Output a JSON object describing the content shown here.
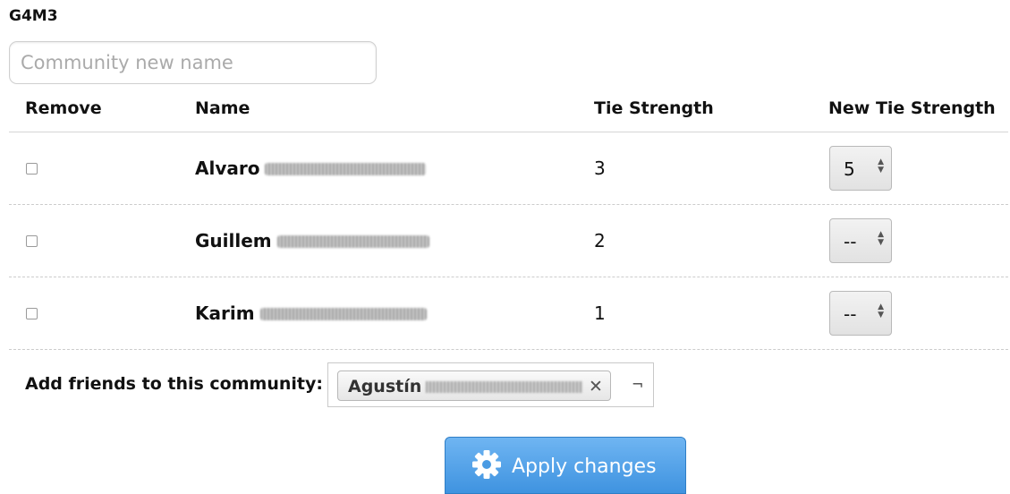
{
  "community": {
    "title": "G4M3",
    "name_placeholder": "Community new name"
  },
  "table": {
    "headers": {
      "remove": "Remove",
      "name": "Name",
      "tie_strength": "Tie Strength",
      "new_tie_strength": "New Tie Strength"
    },
    "rows": [
      {
        "name": "Alvaro",
        "tie_strength": "3",
        "new_tie_strength": "5",
        "removed": false
      },
      {
        "name": "Guillem",
        "tie_strength": "2",
        "new_tie_strength": "--",
        "removed": false
      },
      {
        "name": "Karim",
        "tie_strength": "1",
        "new_tie_strength": "--",
        "removed": false
      }
    ]
  },
  "add_friends": {
    "label": "Add friends to this community:",
    "selected": [
      {
        "name": "Agustín",
        "remove_symbol": "✕"
      }
    ],
    "caret_symbol": "¬"
  },
  "apply_button": {
    "label": "Apply changes",
    "icon": "gear-icon"
  }
}
